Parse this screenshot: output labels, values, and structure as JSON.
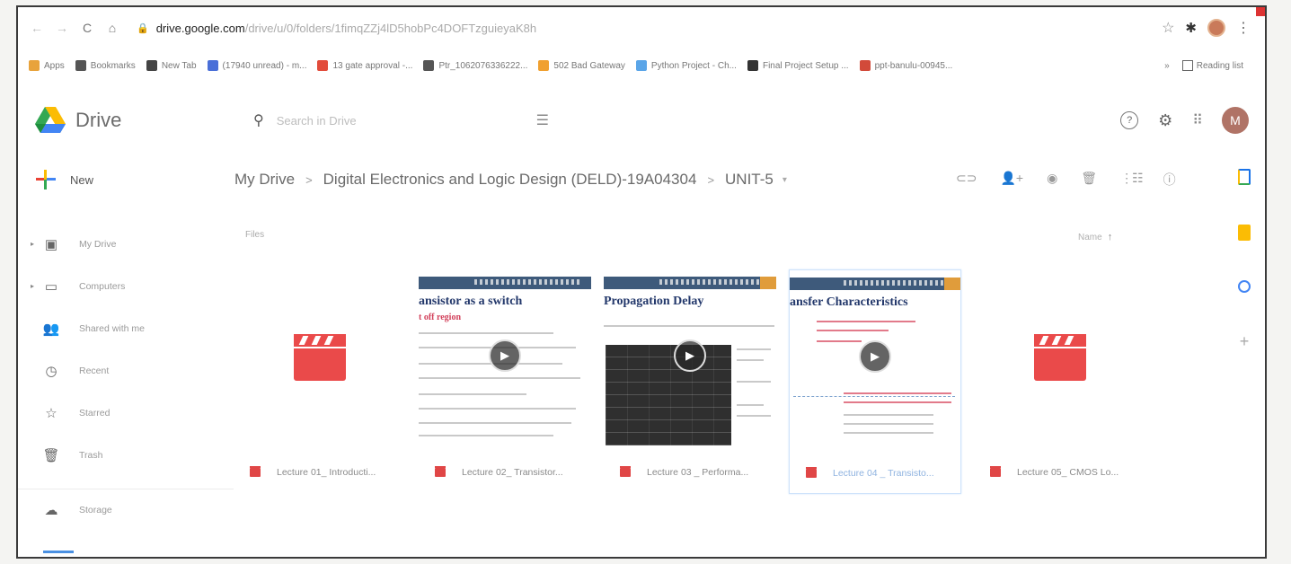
{
  "browser": {
    "url_host": "drive.google.com",
    "url_path": "/drive/u/0/folders/1fimqZZj4lD5hobPc4DOFTzguieyaK8h",
    "bookmarks": [
      {
        "label": "Apps",
        "color": "#e8a33c"
      },
      {
        "label": "Bookmarks",
        "color": "#555555"
      },
      {
        "label": "New Tab",
        "color": "#444444"
      },
      {
        "label": "(17940 unread) - m...",
        "color": "#4a6fd8"
      },
      {
        "label": "13 gate approval -...",
        "color": "#e24c3b"
      },
      {
        "label": "Ptr_1062076336222...",
        "color": "#555555"
      },
      {
        "label": "502 Bad Gateway",
        "color": "#f0a030"
      },
      {
        "label": "Python Project - Ch...",
        "color": "#5aa5e8"
      },
      {
        "label": "Final Project Setup ...",
        "color": "#333333"
      },
      {
        "label": "ppt-banulu-00945...",
        "color": "#d24a3a"
      }
    ],
    "reading_list": "Reading list"
  },
  "drive": {
    "logo_text": "Drive",
    "search_placeholder": "Search in Drive",
    "avatar_initial": "M"
  },
  "sidebar": {
    "new_label": "New",
    "items": [
      {
        "label": "My Drive",
        "icon": "my-drive-icon",
        "glyph": "▣",
        "caret": true
      },
      {
        "label": "Computers",
        "icon": "computers-icon",
        "glyph": "▭",
        "caret": true
      },
      {
        "label": "Shared with me",
        "icon": "shared-icon",
        "glyph": "👥",
        "caret": false
      },
      {
        "label": "Recent",
        "icon": "recent-icon",
        "glyph": "◷",
        "caret": false
      },
      {
        "label": "Starred",
        "icon": "star-icon",
        "glyph": "☆",
        "caret": false
      },
      {
        "label": "Trash",
        "icon": "trash-icon",
        "glyph": "🗑",
        "caret": false
      }
    ],
    "storage_label": "Storage"
  },
  "breadcrumb": {
    "root": "My Drive",
    "parent": "Digital Electronics and Logic Design (DELD)-19A04304",
    "current": "UNIT-5"
  },
  "content": {
    "files_label": "Files",
    "sort_label": "Name"
  },
  "files": [
    {
      "name": "Lecture 01_ Introducti...",
      "thumb": "clapper"
    },
    {
      "name": "Lecture 02_ Transistor...",
      "thumb": "slide",
      "slide_title": "ansistor as a switch",
      "slide_sub": "t off region"
    },
    {
      "name": "Lecture 03 _ Performa...",
      "thumb": "slide",
      "slide_title": "Propagation Delay",
      "slide_sub": ""
    },
    {
      "name": "Lecture 04 _ Transisto...",
      "thumb": "slide",
      "slide_title": "ansfer Characteristics",
      "slide_sub": "",
      "selected": true
    },
    {
      "name": "Lecture 05_ CMOS Lo...",
      "thumb": "clapper"
    }
  ]
}
